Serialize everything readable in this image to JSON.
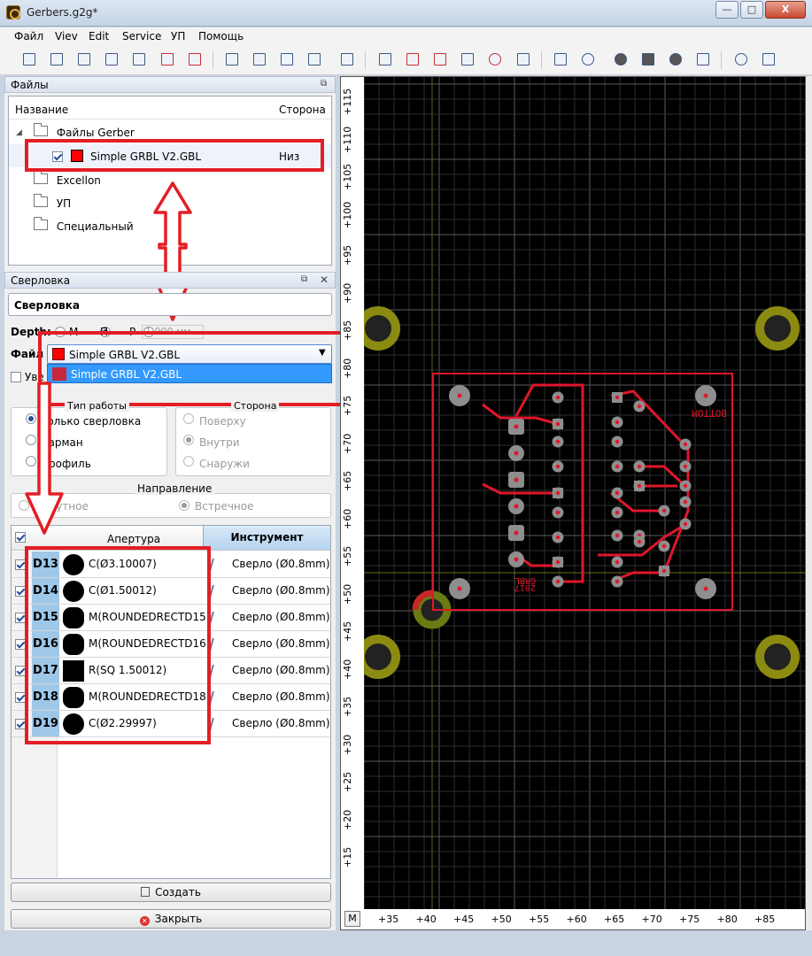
{
  "window": {
    "title": "Gerbers.g2g*",
    "min": "—",
    "max": "□",
    "close": "X"
  },
  "menu": [
    "Файл",
    "Viev",
    "Edit",
    "Service",
    "УП",
    "Помощь"
  ],
  "files_panel": {
    "title": "Файлы",
    "col_name": "Название",
    "col_side": "Сторона",
    "tree": [
      {
        "label": "Файлы Gerber"
      },
      {
        "label": "Simple GRBL V2.GBL",
        "side": "Низ",
        "color": "#ff0000",
        "checked": true
      },
      {
        "label": "Excellon"
      },
      {
        "label": "УП"
      },
      {
        "label": "Специальный"
      }
    ]
  },
  "drill_panel": {
    "title": "Сверловка",
    "name_value": "Сверловка",
    "depth_label": "Depth:",
    "depth_opts": [
      "М",
      "П",
      "Р"
    ],
    "depth_value": "1.000 мм",
    "file_label": "Файл",
    "file_selected": "Simple GRBL V2.GBL",
    "file_options": [
      "Simple GRBL V2.GBL"
    ],
    "option_color": "#c8283c",
    "enlarge_label": "Увел",
    "work_type": {
      "title": "Тип работы",
      "options": [
        "Только сверловка",
        "Карман",
        "Профиль"
      ]
    },
    "side": {
      "title": "Сторона",
      "options": [
        "Поверху",
        "Внутри",
        "Снаружи"
      ]
    },
    "direction": {
      "title": "Направление",
      "options": [
        "Попутное",
        "Встречное"
      ]
    },
    "table": {
      "col_aperture": "Апертура",
      "col_tool": "Инструмент",
      "rows": [
        {
          "d": "D13",
          "shape": "circle",
          "ap": "C(Ø3.10007)",
          "tool": "Сверло (Ø0.8mm)"
        },
        {
          "d": "D14",
          "shape": "circle",
          "ap": "C(Ø1.50012)",
          "tool": "Сверло (Ø0.8mm)"
        },
        {
          "d": "D15",
          "shape": "round",
          "ap": "M(ROUNDEDRECTD15)",
          "tool": "Сверло (Ø0.8mm)"
        },
        {
          "d": "D16",
          "shape": "round",
          "ap": "M(ROUNDEDRECTD16)",
          "tool": "Сверло (Ø0.8mm)"
        },
        {
          "d": "D17",
          "shape": "square",
          "ap": "R(SQ 1.50012)",
          "tool": "Сверло (Ø0.8mm)"
        },
        {
          "d": "D18",
          "shape": "round",
          "ap": "M(ROUNDEDRECTD18)",
          "tool": "Сверло (Ø0.8mm)"
        },
        {
          "d": "D19",
          "shape": "circle",
          "ap": "C(Ø2.29997)",
          "tool": "Сверло (Ø0.8mm)"
        }
      ]
    },
    "create_label": "Создать",
    "close_label": "Закрыть"
  },
  "canvas": {
    "corner": "M",
    "y_ticks": [
      "+115",
      "+110",
      "+105",
      "+100",
      "+95",
      "+90",
      "+85",
      "+80",
      "+75",
      "+70",
      "+65",
      "+60",
      "+55",
      "+50",
      "+45",
      "+40",
      "+35",
      "+30",
      "+25",
      "+20",
      "+15"
    ],
    "x_ticks": [
      "+35",
      "+40",
      "+45",
      "+50",
      "+55",
      "+60",
      "+65",
      "+70",
      "+75",
      "+80",
      "+85"
    ],
    "board_text_top": "BOTTOM",
    "board_text_bot1": "GRBL",
    "board_text_bot2": "2017"
  }
}
